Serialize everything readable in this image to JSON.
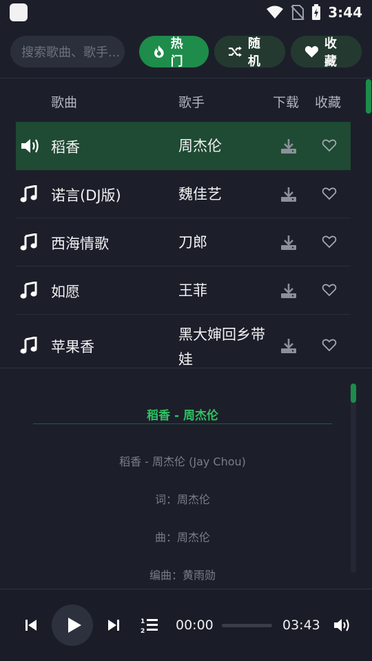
{
  "status_bar": {
    "time": "3:44"
  },
  "search": {
    "placeholder": "搜索歌曲、歌手..."
  },
  "filters": [
    {
      "label": "热门",
      "icon": "fire-icon",
      "active": true
    },
    {
      "label": "随机",
      "icon": "shuffle-icon",
      "active": false
    },
    {
      "label": "收藏",
      "icon": "heart-icon",
      "active": false
    }
  ],
  "table": {
    "headers": {
      "song": "歌曲",
      "artist": "歌手",
      "download": "下载",
      "favorite": "收藏"
    },
    "rows": [
      {
        "title": "稻香",
        "artist": "周杰伦",
        "playing": true
      },
      {
        "title": "诺言(DJ版)",
        "artist": "魏佳艺",
        "playing": false
      },
      {
        "title": "西海情歌",
        "artist": "刀郎",
        "playing": false
      },
      {
        "title": "如愿",
        "artist": "王菲",
        "playing": false
      },
      {
        "title": "苹果香",
        "artist": "黑大婶回乡带娃",
        "playing": false
      }
    ]
  },
  "lyrics": {
    "title": "稻香 - 周杰伦",
    "lines": [
      "稻香 - 周杰伦 (Jay Chou)",
      "词：周杰伦",
      "曲：周杰伦",
      "编曲：黄雨勋"
    ]
  },
  "player": {
    "current_time": "00:00",
    "total_time": "03:43",
    "progress": 0
  },
  "colors": {
    "accent": "#1e8c4a",
    "background": "#1c1f2a",
    "lyric_title": "#2ec261"
  }
}
